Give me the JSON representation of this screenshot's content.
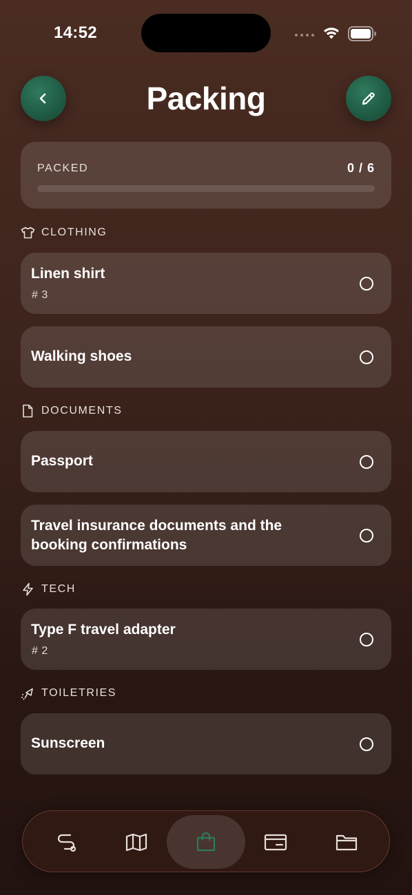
{
  "status_bar": {
    "time": "14:52"
  },
  "header": {
    "title": "Packing",
    "back_icon": "chevron-left-icon",
    "edit_icon": "pencil-icon"
  },
  "progress": {
    "label": "PACKED",
    "count": "0 / 6",
    "fraction": 0
  },
  "sections": [
    {
      "name": "CLOTHING",
      "icon": "shirt-icon",
      "items": [
        {
          "title": "Linen shirt",
          "qty": "# 3"
        },
        {
          "title": "Walking shoes"
        }
      ]
    },
    {
      "name": "DOCUMENTS",
      "icon": "document-icon",
      "items": [
        {
          "title": "Passport"
        },
        {
          "title": "Travel insurance documents and the booking confirmations"
        }
      ]
    },
    {
      "name": "TECH",
      "icon": "lightning-icon",
      "items": [
        {
          "title": "Type F travel adapter",
          "qty": "# 2"
        }
      ]
    },
    {
      "name": "TOILETRIES",
      "icon": "spray-icon",
      "items": [
        {
          "title": "Sunscreen"
        }
      ]
    }
  ],
  "tab_bar": {
    "tabs": [
      {
        "icon": "route-icon",
        "active": false
      },
      {
        "icon": "map-icon",
        "active": false
      },
      {
        "icon": "bag-icon",
        "active": true
      },
      {
        "icon": "wallet-card-icon",
        "active": false
      },
      {
        "icon": "folder-icon",
        "active": false
      }
    ]
  },
  "colors": {
    "accent": "#2f7a5d",
    "background": "#3a221b",
    "card": "#5a423d"
  }
}
